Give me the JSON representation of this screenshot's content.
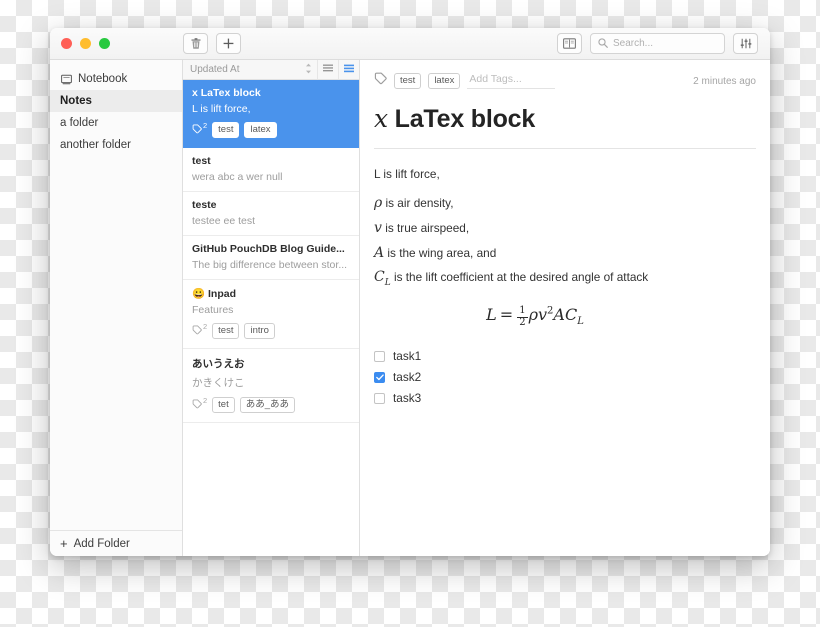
{
  "window": {
    "traffic_lights": [
      "close",
      "minimize",
      "zoom"
    ],
    "accent_color": "#4a93ec"
  },
  "toolbar": {
    "delete_label": "",
    "add_label": "",
    "icons": [
      "trash-icon",
      "plus-icon",
      "book-icon",
      "sliders-icon"
    ]
  },
  "search": {
    "value": "",
    "placeholder": "Search..."
  },
  "sidebar": {
    "items": [
      {
        "label": "Notebook",
        "icon": "notebook-icon",
        "active": false
      },
      {
        "label": "Notes",
        "icon": "",
        "active": true
      },
      {
        "label": "a folder",
        "icon": "",
        "active": false
      },
      {
        "label": "another folder",
        "icon": "",
        "active": false
      }
    ],
    "add_folder_label": "Add Folder"
  },
  "notelist": {
    "sort_label": "Updated At",
    "notes": [
      {
        "emoji": "",
        "title": "x LaTex block",
        "snippet": "L is lift force,",
        "tag_count": "2",
        "tags": [
          "test",
          "latex"
        ],
        "selected": true
      },
      {
        "emoji": "",
        "title": "test",
        "snippet": "wera abc a wer null",
        "tag_count": "",
        "tags": [],
        "selected": false
      },
      {
        "emoji": "",
        "title": "teste",
        "snippet": "testee ee test",
        "tag_count": "",
        "tags": [],
        "selected": false
      },
      {
        "emoji": "",
        "title": "GitHub PouchDB Blog Guide...",
        "snippet": "The big difference between stor...",
        "tag_count": "",
        "tags": [],
        "selected": false
      },
      {
        "emoji": "😀",
        "title": "Inpad",
        "snippet": "Features",
        "tag_count": "2",
        "tags": [
          "test",
          "intro"
        ],
        "selected": false
      },
      {
        "emoji": "",
        "title": "あいうえお",
        "snippet": "かきくけこ",
        "tag_count": "2",
        "tags": [
          "tet",
          "ああ_ああ"
        ],
        "selected": false
      }
    ]
  },
  "editor": {
    "tags": [
      "test",
      "latex"
    ],
    "add_tags_placeholder": "Add Tags...",
    "updated_at": "2 minutes ago",
    "title_symbol": "x",
    "title_text": " LaTex block",
    "paragraphs": [
      {
        "lead": "",
        "text": "L is lift force,"
      },
      {
        "lead": "ρ",
        "text": " is air density,"
      },
      {
        "lead": "v",
        "text": " is true airspeed,"
      },
      {
        "lead": "A",
        "text": " is the wing area, and"
      },
      {
        "lead": "C",
        "sub": "L",
        "text": " is the lift coefficient at the desired angle of attack"
      }
    ],
    "formula": {
      "lhs": "L",
      "equals": "=",
      "fraction_num": "1",
      "fraction_den": "2",
      "rho": "ρ",
      "v": "v",
      "v_exp": "2",
      "a": "A",
      "c": "C",
      "c_sub": "L",
      "plain": "L = 1/2 ρv²AC_L"
    },
    "tasks": [
      {
        "label": "task1",
        "checked": false
      },
      {
        "label": "task2",
        "checked": true
      },
      {
        "label": "task3",
        "checked": false
      }
    ]
  }
}
